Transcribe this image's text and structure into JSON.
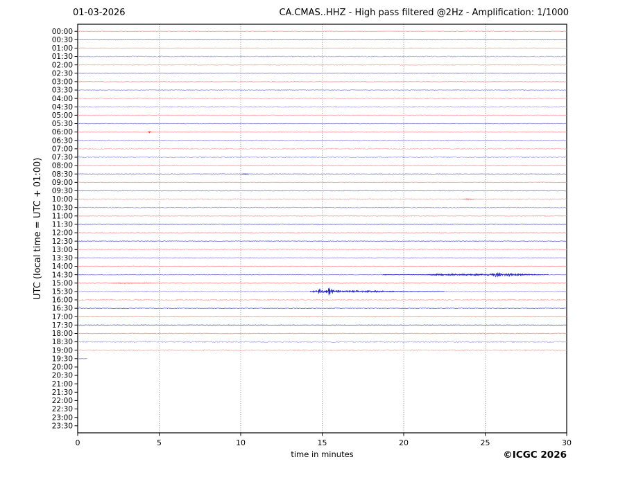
{
  "header": {
    "date": "01-03-2026",
    "title": "CA.CMAS..HHZ - High pass filtered @2Hz - Amplification: 1/1000"
  },
  "footer": {
    "copyright": "©ICGC 2026"
  },
  "chart_data": {
    "type": "line",
    "variant": "helicorder-seismogram",
    "title": "CA.CMAS..HHZ - High pass filtered @2Hz - Amplification: 1/1000",
    "date": "01-03-2026",
    "xlabel": "time in minutes",
    "ylabel": "UTC (local time = UTC + 01:00)",
    "xlim": [
      0,
      30
    ],
    "x_ticks": [
      0,
      5,
      10,
      15,
      20,
      25,
      30
    ],
    "minutes_per_line": 30,
    "grid": {
      "vertical": true,
      "style": "dotted",
      "interval_min": 5
    },
    "amplitude_units": "px",
    "rows": [
      {
        "t": "00:00",
        "color": "#ff9c9c",
        "noise": 0.4,
        "span": [
          0,
          30
        ]
      },
      {
        "t": "00:30",
        "color": "#8080dc",
        "noise": 0.4,
        "span": [
          0,
          30
        ]
      },
      {
        "t": "01:00",
        "color": "#ffa2a2",
        "noise": 0.45,
        "span": [
          0,
          30
        ]
      },
      {
        "t": "01:30",
        "color": "#a8a8ea",
        "noise": 0.7,
        "span": [
          0,
          30
        ]
      },
      {
        "t": "02:00",
        "color": "#ffaaaa",
        "noise": 0.6,
        "span": [
          0,
          30
        ]
      },
      {
        "t": "02:30",
        "color": "#8080dc",
        "noise": 0.4,
        "span": [
          0,
          30
        ]
      },
      {
        "t": "03:00",
        "color": "#ff9898",
        "noise": 0.45,
        "span": [
          0,
          30
        ]
      },
      {
        "t": "03:30",
        "color": "#9090e2",
        "noise": 0.5,
        "span": [
          0,
          30
        ]
      },
      {
        "t": "04:00",
        "color": "#ffb0b0",
        "noise": 0.7,
        "span": [
          0,
          30
        ]
      },
      {
        "t": "04:30",
        "color": "#b2b2ee",
        "noise": 0.8,
        "span": [
          0,
          30
        ]
      },
      {
        "t": "05:00",
        "color": "#ffa4a4",
        "noise": 0.5,
        "span": [
          0,
          30
        ]
      },
      {
        "t": "05:30",
        "color": "#8080dc",
        "noise": 0.4,
        "span": [
          0,
          30
        ]
      },
      {
        "t": "06:00",
        "color": "#ff9c9c",
        "noise": 0.45,
        "span": [
          0,
          30
        ]
      },
      {
        "t": "06:30",
        "color": "#9494e2",
        "noise": 0.5,
        "span": [
          0,
          30
        ]
      },
      {
        "t": "07:00",
        "color": "#ffb4b4",
        "noise": 0.9,
        "span": [
          0,
          30
        ]
      },
      {
        "t": "07:30",
        "color": "#aaaae8",
        "noise": 0.7,
        "span": [
          0,
          30
        ]
      },
      {
        "t": "08:00",
        "color": "#ff9898",
        "noise": 0.45,
        "span": [
          0,
          30
        ]
      },
      {
        "t": "08:30",
        "color": "#8080dc",
        "noise": 0.4,
        "span": [
          0,
          30
        ]
      },
      {
        "t": "09:00",
        "color": "#ff9c9c",
        "noise": 0.45,
        "span": [
          0,
          30
        ]
      },
      {
        "t": "09:30",
        "color": "#8888de",
        "noise": 0.45,
        "span": [
          0,
          30
        ]
      },
      {
        "t": "10:00",
        "color": "#ffb0b0",
        "noise": 0.8,
        "span": [
          0,
          30
        ]
      },
      {
        "t": "10:30",
        "color": "#9c9ce4",
        "noise": 0.6,
        "span": [
          0,
          30
        ]
      },
      {
        "t": "11:00",
        "color": "#ffa4a4",
        "noise": 0.5,
        "span": [
          0,
          30
        ]
      },
      {
        "t": "11:30",
        "color": "#6a6ad6",
        "noise": 0.4,
        "span": [
          0,
          30
        ]
      },
      {
        "t": "12:00",
        "color": "#ff9c9c",
        "noise": 0.45,
        "span": [
          0,
          30
        ]
      },
      {
        "t": "12:30",
        "color": "#6e6ed6",
        "noise": 0.5,
        "span": [
          0,
          30
        ]
      },
      {
        "t": "13:00",
        "color": "#ffb0b0",
        "noise": 0.8,
        "span": [
          0,
          30
        ]
      },
      {
        "t": "13:30",
        "color": "#9090e0",
        "noise": 0.5,
        "span": [
          0,
          30
        ]
      },
      {
        "t": "14:00",
        "color": "#ff9494",
        "noise": 0.45,
        "span": [
          0,
          30
        ]
      },
      {
        "t": "14:30",
        "color": "#7a7ada",
        "noise": 0.45,
        "span": [
          0,
          30
        ]
      },
      {
        "t": "15:00",
        "color": "#ff9494",
        "noise": 0.5,
        "span": [
          0,
          30
        ]
      },
      {
        "t": "15:30",
        "color": "#a0a0e6",
        "noise": 0.6,
        "span": [
          0,
          30
        ]
      },
      {
        "t": "16:00",
        "color": "#ffb2b2",
        "noise": 1.0,
        "span": [
          0,
          30
        ]
      },
      {
        "t": "16:30",
        "color": "#7070d8",
        "noise": 0.5,
        "span": [
          0,
          30
        ]
      },
      {
        "t": "17:00",
        "color": "#ff9494",
        "noise": 0.5,
        "span": [
          0,
          30
        ]
      },
      {
        "t": "17:30",
        "color": "#5c5cd2",
        "noise": 0.45,
        "span": [
          0,
          30
        ]
      },
      {
        "t": "18:00",
        "color": "#ff9494",
        "noise": 0.55,
        "span": [
          0,
          30
        ]
      },
      {
        "t": "18:30",
        "color": "#b2b2ee",
        "noise": 1.0,
        "span": [
          0,
          30
        ]
      },
      {
        "t": "19:00",
        "color": "#ffb4b4",
        "noise": 0.9,
        "span": [
          0,
          30
        ]
      },
      {
        "t": "19:30",
        "color": "#8080dc",
        "noise": 0.4,
        "span": [
          0,
          0.6
        ]
      },
      {
        "t": "20:00",
        "span": null
      },
      {
        "t": "20:30",
        "span": null
      },
      {
        "t": "21:00",
        "span": null
      },
      {
        "t": "21:30",
        "span": null
      },
      {
        "t": "22:00",
        "span": null
      },
      {
        "t": "22:30",
        "span": null
      },
      {
        "t": "23:00",
        "span": null
      },
      {
        "t": "23:30",
        "span": null
      }
    ],
    "events": [
      {
        "row": "06:00",
        "color": "#ff3c3c",
        "envelope": [
          [
            4.32,
            0
          ],
          [
            4.42,
            1.7
          ],
          [
            4.52,
            0
          ]
        ]
      },
      {
        "row": "08:30",
        "color": "#4848cc",
        "envelope": [
          [
            10.05,
            0
          ],
          [
            10.25,
            0.8
          ],
          [
            10.5,
            0
          ]
        ]
      },
      {
        "row": "10:00",
        "color": "#ff8484",
        "envelope": [
          [
            23.55,
            0
          ],
          [
            23.95,
            0.9
          ],
          [
            24.35,
            0
          ]
        ]
      },
      {
        "row": "15:00",
        "color": "#ffa0a0",
        "envelope": [
          [
            1.9,
            0.2
          ],
          [
            2.3,
            0.8
          ],
          [
            2.9,
            0.9
          ],
          [
            3.6,
            0.7
          ],
          [
            4.3,
            0.8
          ],
          [
            4.8,
            0
          ]
        ]
      },
      {
        "row": "14:30",
        "color": "#2424c8",
        "envelope": [
          [
            18.7,
            0
          ],
          [
            18.85,
            0.5
          ],
          [
            19.0,
            0.12
          ],
          [
            20.0,
            0.1
          ],
          [
            21.3,
            0.25
          ],
          [
            21.8,
            0.7
          ],
          [
            22.2,
            1.1
          ],
          [
            22.55,
            0.8
          ],
          [
            22.9,
            1.2
          ],
          [
            23.3,
            0.9
          ],
          [
            23.7,
            1.1
          ],
          [
            24.05,
            0.8
          ],
          [
            24.4,
            1.2
          ],
          [
            24.75,
            0.9
          ],
          [
            25.1,
            1.3
          ],
          [
            25.45,
            1.1
          ],
          [
            25.75,
            4.2
          ],
          [
            25.95,
            1.8
          ],
          [
            26.2,
            1.4
          ],
          [
            26.45,
            2.3
          ],
          [
            26.7,
            1.2
          ],
          [
            27.0,
            1.6
          ],
          [
            27.35,
            1.0
          ],
          [
            27.8,
            0.6
          ],
          [
            28.4,
            0.3
          ],
          [
            28.9,
            0
          ]
        ]
      },
      {
        "row": "15:30",
        "color": "#2424c8",
        "envelope": [
          [
            14.25,
            0.3
          ],
          [
            14.5,
            1.2
          ],
          [
            14.7,
            1.8
          ],
          [
            14.9,
            3.2
          ],
          [
            15.05,
            1.4
          ],
          [
            15.3,
            1.6
          ],
          [
            15.45,
            5.5
          ],
          [
            15.65,
            1.8
          ],
          [
            15.9,
            1.1
          ],
          [
            16.2,
            1.4
          ],
          [
            16.6,
            1.0
          ],
          [
            17.0,
            1.3
          ],
          [
            17.4,
            1.0
          ],
          [
            17.8,
            1.2
          ],
          [
            18.2,
            1.3
          ],
          [
            18.6,
            0.9
          ],
          [
            19.0,
            1.0
          ],
          [
            19.4,
            0.6
          ],
          [
            19.9,
            0.4
          ],
          [
            20.5,
            0.25
          ],
          [
            21.5,
            0.12
          ],
          [
            22.5,
            0
          ]
        ]
      }
    ]
  }
}
